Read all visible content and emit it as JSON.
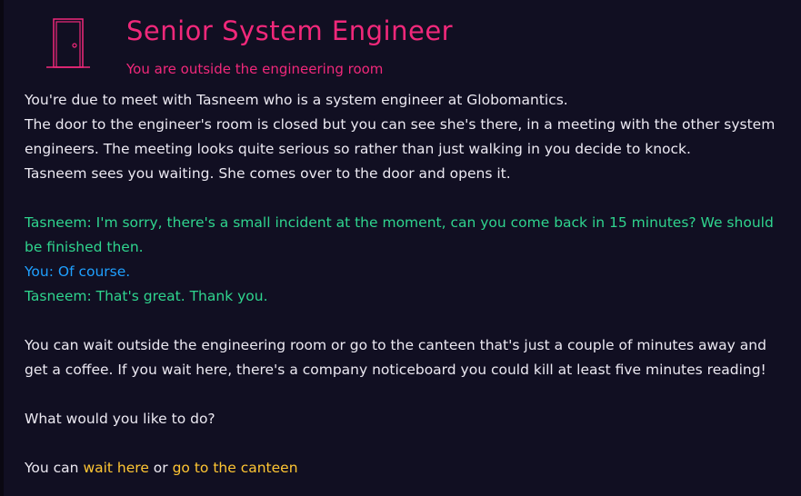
{
  "header": {
    "title": "Senior System Engineer",
    "subtitle": "You are outside the engineering room",
    "icon": "door-icon",
    "accent_color": "#f0287a"
  },
  "narration": [
    "You're due to meet with Tasneem who is a system engineer at Globomantics.",
    "The door to the engineer's room is closed but you can see she's there, in a meeting with the other system engineers. The meeting looks quite serious so rather than just walking in you decide to knock.",
    "Tasneem sees you waiting. She comes over to the door and opens it."
  ],
  "dialogue": [
    {
      "text": "Tasneem: I'm sorry, there's a small incident at the moment, can you come back in 15 minutes? We should be finished then.",
      "color": "#2fd48e"
    },
    {
      "text": "You: Of course.",
      "color": "#1fa0ff"
    },
    {
      "text": "Tasneem: That's great. Thank you.",
      "color": "#2fd48e"
    }
  ],
  "options_text": "You can wait outside the engineering room or go to the canteen that's just a couple of minutes away and get a coffee. If you wait here, there's a company noticeboard you could kill at least five minutes reading!",
  "question": "What would you like to do?",
  "choices": {
    "prefix": "You can",
    "separator": "or",
    "wait_here": "wait here",
    "go_canteen": "go to the canteen",
    "link_color": "#ffc633"
  }
}
